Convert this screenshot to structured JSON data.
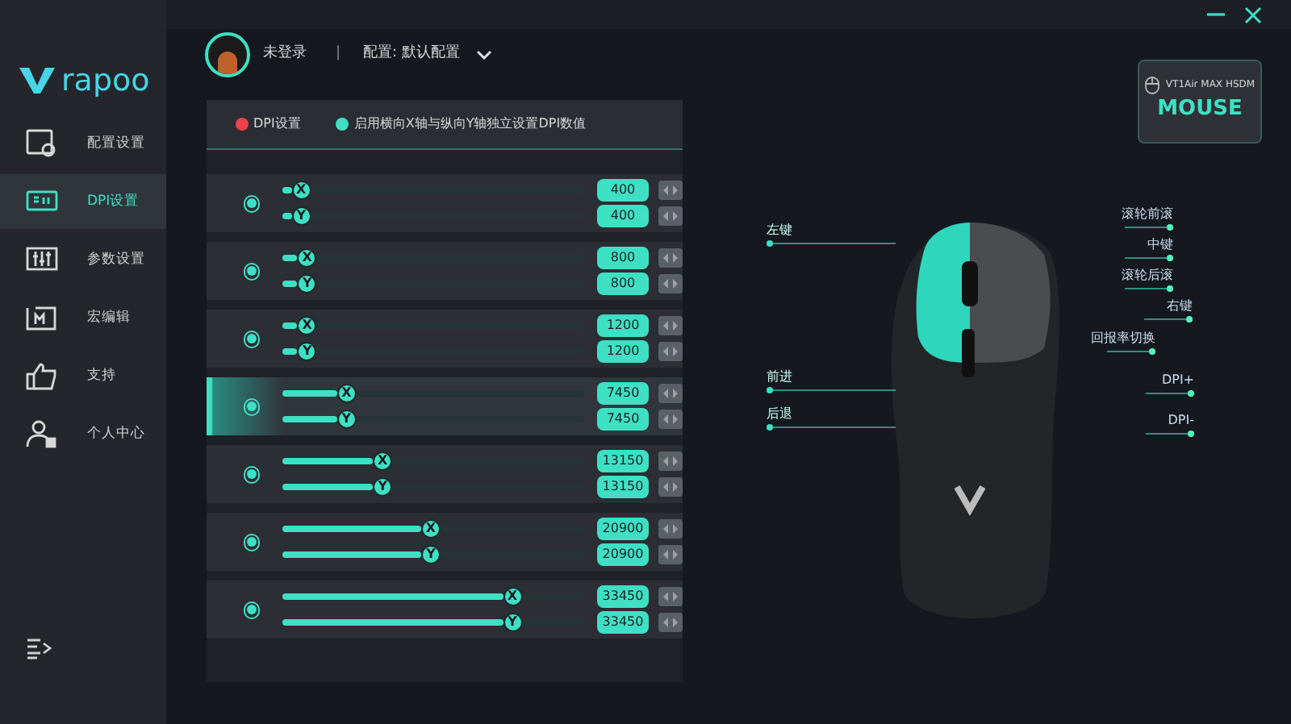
{
  "logo": {
    "text": "rapoo"
  },
  "sidebar": {
    "items": [
      {
        "label": "配置设置",
        "selected": false
      },
      {
        "label": "DPI设置",
        "selected": true
      },
      {
        "label": "参数设置",
        "selected": false
      },
      {
        "label": "宏编辑",
        "selected": false
      },
      {
        "label": "支持",
        "selected": false
      },
      {
        "label": "个人中心",
        "selected": false
      }
    ]
  },
  "header": {
    "user": "未登录",
    "separator": "|",
    "profile": "配置: 默认配置"
  },
  "dpi_panel": {
    "options": [
      {
        "label": "DPI设置",
        "color": "#f0404a"
      },
      {
        "label": "启用横向X轴与纵向Y轴独立设置DPI数值",
        "color": "#3ee0c4"
      }
    ],
    "rows": [
      {
        "selected": false,
        "axes": [
          {
            "axis": "X",
            "level": 0.03,
            "value": "400"
          },
          {
            "axis": "Y",
            "level": 0.03,
            "value": "400"
          }
        ]
      },
      {
        "selected": false,
        "axes": [
          {
            "axis": "X",
            "level": 0.05,
            "value": "800"
          },
          {
            "axis": "Y",
            "level": 0.05,
            "value": "800"
          }
        ]
      },
      {
        "selected": false,
        "axes": [
          {
            "axis": "X",
            "level": 0.05,
            "value": "1200"
          },
          {
            "axis": "Y",
            "level": 0.05,
            "value": "1200"
          }
        ]
      },
      {
        "selected": true,
        "axes": [
          {
            "axis": "X",
            "level": 0.18,
            "value": "7450"
          },
          {
            "axis": "Y",
            "level": 0.18,
            "value": "7450"
          }
        ]
      },
      {
        "selected": false,
        "axes": [
          {
            "axis": "X",
            "level": 0.3,
            "value": "13150"
          },
          {
            "axis": "Y",
            "level": 0.3,
            "value": "13150"
          }
        ]
      },
      {
        "selected": false,
        "axes": [
          {
            "axis": "X",
            "level": 0.46,
            "value": "20900"
          },
          {
            "axis": "Y",
            "level": 0.46,
            "value": "20900"
          }
        ]
      },
      {
        "selected": false,
        "axes": [
          {
            "axis": "X",
            "level": 0.73,
            "value": "33450"
          },
          {
            "axis": "Y",
            "level": 0.73,
            "value": "33450"
          }
        ]
      }
    ]
  },
  "mouse_labels_left": [
    "左键",
    "前进",
    "后退"
  ],
  "mouse_labels_right": [
    "滚轮前滚",
    "中键",
    "滚轮后滚",
    "右键",
    "回报率切换",
    "DPI+",
    "DPI-"
  ],
  "device": {
    "model": "VT1Air MAX HSDM",
    "type": "MOUSE"
  }
}
